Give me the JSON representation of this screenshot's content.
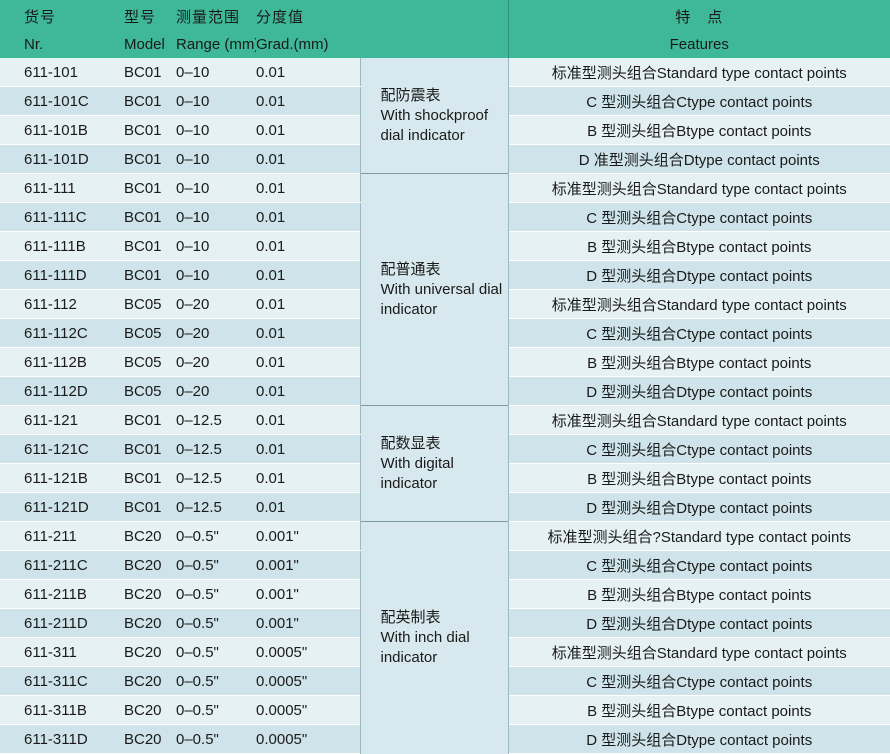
{
  "header": {
    "zh": [
      "货号",
      "型号",
      "测量范围",
      "分度值",
      "特　点"
    ],
    "en": [
      "Nr.",
      "Model",
      "Range (mm)",
      "Grad.(mm)",
      "Features"
    ]
  },
  "colors": {
    "header_bg": "#3fb89a",
    "row_light": "#e6f1f4",
    "row_dark": "#cfe4ea",
    "group_bg": "#d7e9ee"
  },
  "groups": [
    {
      "label_zh": "配防震表",
      "label_en": "With shockproof dial indicator",
      "rows": [
        {
          "nr": "611-101",
          "model": "BC01",
          "range": "0–10",
          "grad": "0.01",
          "feature": "标准型测头组合Standard type contact points"
        },
        {
          "nr": "611-101C",
          "model": "BC01",
          "range": "0–10",
          "grad": "0.01",
          "feature": "C 型测头组合Ctype contact points"
        },
        {
          "nr": "611-101B",
          "model": "BC01",
          "range": "0–10",
          "grad": "0.01",
          "feature": "B 型测头组合Btype contact points"
        },
        {
          "nr": "611-101D",
          "model": "BC01",
          "range": "0–10",
          "grad": "0.01",
          "feature": "D 准型测头组合Dtype contact points"
        }
      ]
    },
    {
      "label_zh": "配普通表",
      "label_en": "With universal dial indicator",
      "rows": [
        {
          "nr": "611-111",
          "model": "BC01",
          "range": "0–10",
          "grad": "0.01",
          "feature": "标准型测头组合Standard type contact points"
        },
        {
          "nr": "611-111C",
          "model": "BC01",
          "range": "0–10",
          "grad": "0.01",
          "feature": "C 型测头组合Ctype contact points"
        },
        {
          "nr": "611-111B",
          "model": "BC01",
          "range": "0–10",
          "grad": "0.01",
          "feature": "B 型测头组合Btype contact points"
        },
        {
          "nr": "611-111D",
          "model": "BC01",
          "range": "0–10",
          "grad": "0.01",
          "feature": "D 型测头组合Dtype contact points"
        },
        {
          "nr": "611-112",
          "model": "BC05",
          "range": "0–20",
          "grad": "0.01",
          "feature": "标准型测头组合Standard type contact points"
        },
        {
          "nr": "611-112C",
          "model": "BC05",
          "range": "0–20",
          "grad": "0.01",
          "feature": "C 型测头组合Ctype contact points"
        },
        {
          "nr": "611-112B",
          "model": "BC05",
          "range": "0–20",
          "grad": "0.01",
          "feature": "B 型测头组合Btype contact points"
        },
        {
          "nr": "611-112D",
          "model": "BC05",
          "range": "0–20",
          "grad": "0.01",
          "feature": "D 型测头组合Dtype contact points"
        }
      ]
    },
    {
      "label_zh": "配数显表",
      "label_en": "With digital indicator",
      "rows": [
        {
          "nr": "611-121",
          "model": "BC01",
          "range": "0–12.5",
          "grad": "0.01",
          "feature": "标准型测头组合Standard type contact points"
        },
        {
          "nr": "611-121C",
          "model": "BC01",
          "range": "0–12.5",
          "grad": "0.01",
          "feature": "C 型测头组合Ctype contact points"
        },
        {
          "nr": "611-121B",
          "model": "BC01",
          "range": "0–12.5",
          "grad": "0.01",
          "feature": "B 型测头组合Btype contact points"
        },
        {
          "nr": "611-121D",
          "model": "BC01",
          "range": "0–12.5",
          "grad": "0.01",
          "feature": "D 型测头组合Dtype contact points"
        }
      ]
    },
    {
      "label_zh": "配英制表",
      "label_en": "With inch dial indicator",
      "rows": [
        {
          "nr": "611-211",
          "model": "BC20",
          "range": "0–0.5\"",
          "grad": "0.001\"",
          "feature": "标准型测头组合?Standard type contact points"
        },
        {
          "nr": "611-211C",
          "model": "BC20",
          "range": "0–0.5\"",
          "grad": "0.001\"",
          "feature": "C 型测头组合Ctype contact points"
        },
        {
          "nr": "611-211B",
          "model": "BC20",
          "range": "0–0.5\"",
          "grad": "0.001\"",
          "feature": "B 型测头组合Btype contact points"
        },
        {
          "nr": "611-211D",
          "model": "BC20",
          "range": "0–0.5\"",
          "grad": "0.001\"",
          "feature": "D 型测头组合Dtype contact points"
        },
        {
          "nr": "611-311",
          "model": "BC20",
          "range": "0–0.5\"",
          "grad": "0.0005\"",
          "feature": "标准型测头组合Standard type contact points"
        },
        {
          "nr": "611-311C",
          "model": "BC20",
          "range": "0–0.5\"",
          "grad": "0.0005\"",
          "feature": "C 型测头组合Ctype contact points"
        },
        {
          "nr": "611-311B",
          "model": "BC20",
          "range": "0–0.5\"",
          "grad": "0.0005\"",
          "feature": "B 型测头组合Btype contact points"
        },
        {
          "nr": "611-311D",
          "model": "BC20",
          "range": "0–0.5\"",
          "grad": "0.0005\"",
          "feature": "D 型测头组合Dtype contact points"
        }
      ]
    }
  ]
}
